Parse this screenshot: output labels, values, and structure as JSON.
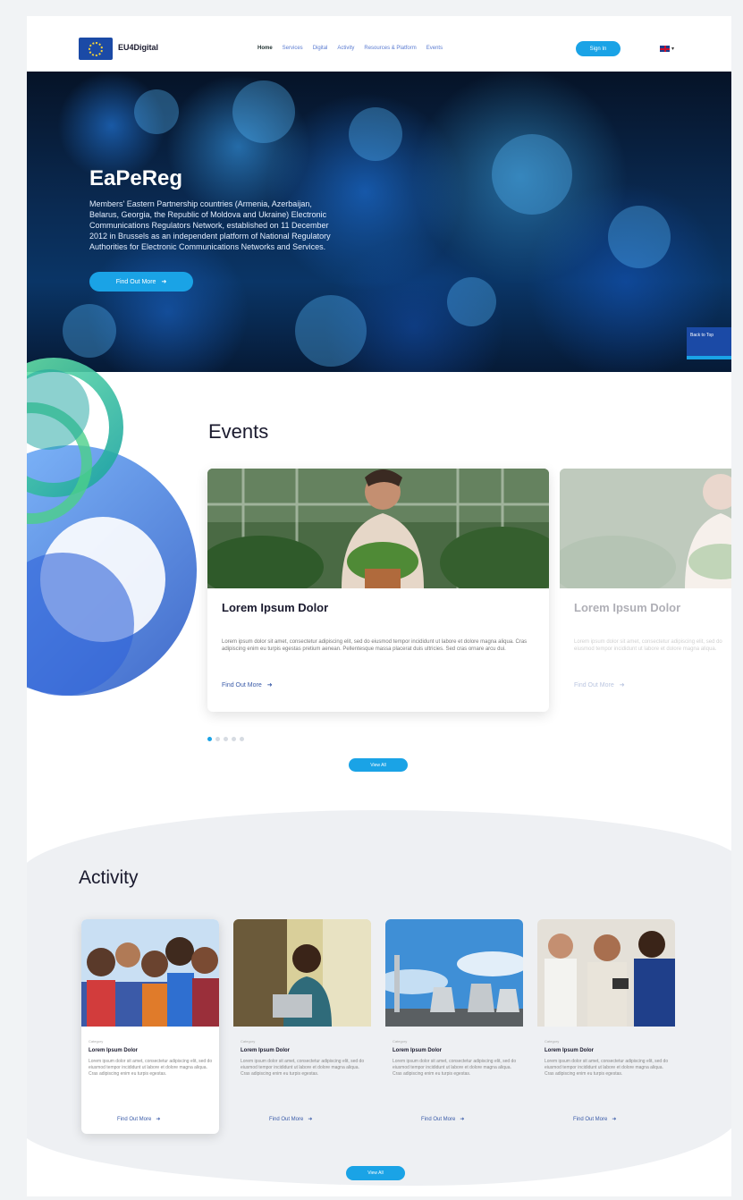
{
  "nav": {
    "brand": "EU4Digital",
    "links": [
      "Home",
      "Services",
      "Digital",
      "Activity",
      "Resources & Platform",
      "Events"
    ],
    "sign_in": "Sign In",
    "language_icon": "uk-flag-icon"
  },
  "hero": {
    "title": "EaPeReg",
    "description": "Members' Eastern Partnership countries (Armenia, Azerbaijan, Belarus, Georgia, the Republic of Moldova and Ukraine) Electronic Communications Regulators Network, established on 11 December 2012 in Brussels as an independent platform of National Regulatory Authorities for Electronic Communications Networks and Services.",
    "button": "Find Out More",
    "side_button": "Back to Top"
  },
  "events": {
    "title": "Events",
    "cards": [
      {
        "title": "Lorem Ipsum Dolor",
        "subtitle": "",
        "body": "Lorem ipsum dolor sit amet, consectetur adipiscing elit, sed do eiusmod tempor incididunt ut labore et dolore magna aliqua. Cras adipiscing enim eu turpis egestas pretium aenean. Pellentesque massa placerat duis ultricies. Sed cras ornare arcu dui.",
        "link": "Find Out More"
      },
      {
        "title": "Lorem Ipsum Dolor",
        "subtitle": "",
        "body": "Lorem ipsum dolor sit amet, consectetur adipiscing elit, sed do eiusmod tempor incididunt ut labore et dolore magna aliqua.",
        "link": "Find Out More"
      }
    ],
    "view_all": "View All"
  },
  "activity": {
    "title": "Activity",
    "cards": [
      {
        "category": "Category",
        "title": "Lorem Ipsum Dolor",
        "body": "Lorem ipsum dolor sit amet, consectetur adipiscing elit, sed do eiusmod tempor incididunt ut labore et dolore magna aliqua. Cras adipiscing enim eu turpis egestas.",
        "link": "Find Out More"
      },
      {
        "category": "Category",
        "title": "Lorem Ipsum Dolor",
        "body": "Lorem ipsum dolor sit amet, consectetur adipiscing elit, sed do eiusmod tempor incididunt ut labore et dolore magna aliqua. Cras adipiscing enim eu turpis egestas.",
        "link": "Find Out More"
      },
      {
        "category": "Category",
        "title": "Lorem Ipsum Dolor",
        "body": "Lorem ipsum dolor sit amet, consectetur adipiscing elit, sed do eiusmod tempor incididunt ut labore et dolore magna aliqua. Cras adipiscing enim eu turpis egestas.",
        "link": "Find Out More"
      },
      {
        "category": "Category",
        "title": "Lorem Ipsum Dolor",
        "body": "Lorem ipsum dolor sit amet, consectetur adipiscing elit, sed do eiusmod tempor incididunt ut labore et dolore magna aliqua. Cras adipiscing enim eu turpis egestas.",
        "link": "Find Out More"
      }
    ],
    "view_all": "View All"
  },
  "colors": {
    "accent": "#1aa3e6",
    "brand_blue": "#1b4aa6",
    "link": "#3a5ba8"
  }
}
